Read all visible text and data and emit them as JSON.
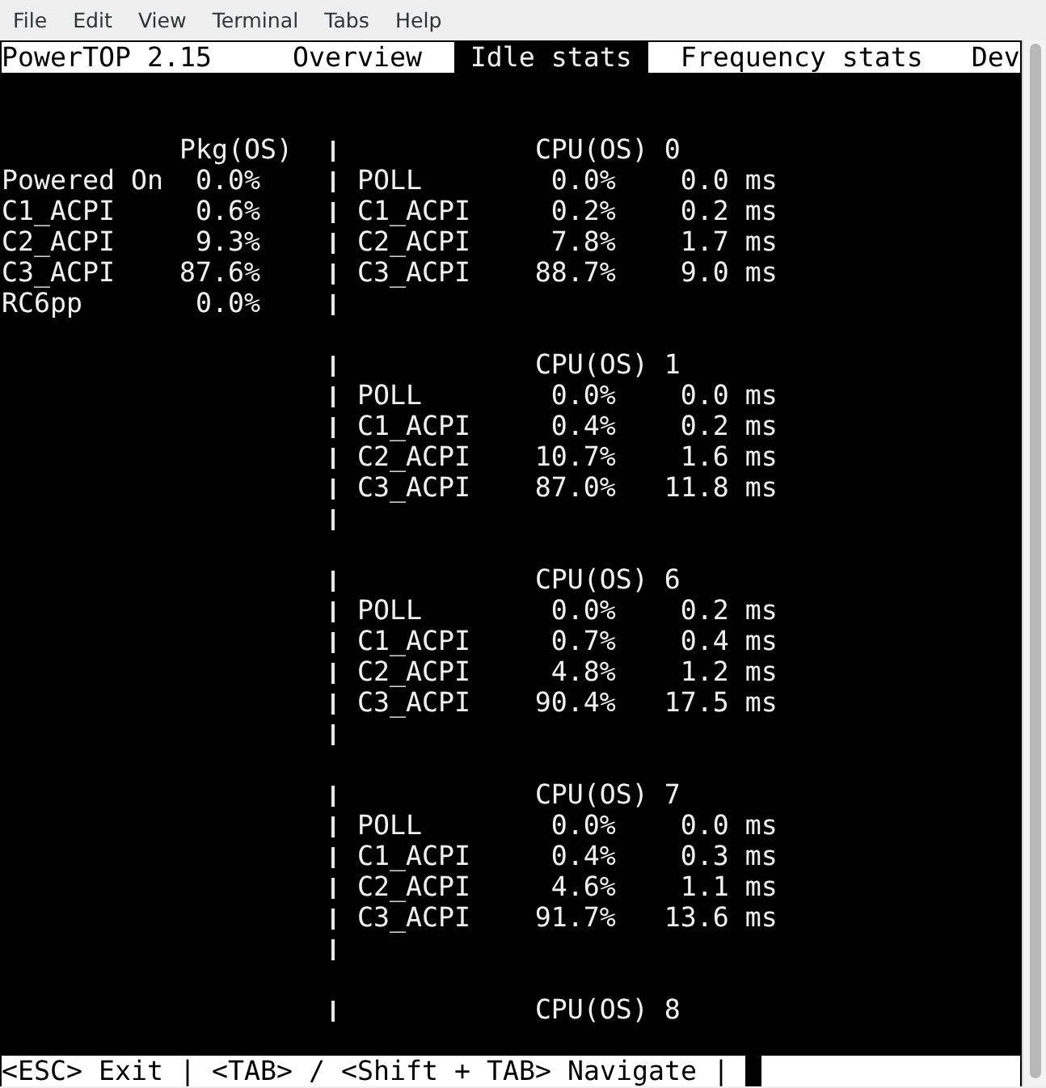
{
  "menu_bar": [
    "File",
    "Edit",
    "View",
    "Terminal",
    "Tabs",
    "Help"
  ],
  "header": {
    "title": "PowerTOP 2.15",
    "tabs": [
      {
        "label": "Overview",
        "selected": false
      },
      {
        "label": "Idle stats",
        "selected": true
      },
      {
        "label": "Frequency stats",
        "selected": false
      },
      {
        "label": "Dev",
        "selected": false
      }
    ]
  },
  "package": {
    "header": "Pkg(OS)",
    "rows": [
      {
        "name": "Powered On",
        "percent": "0.0%"
      },
      {
        "name": "C1_ACPI",
        "percent": "0.6%"
      },
      {
        "name": "C2_ACPI",
        "percent": "9.3%"
      },
      {
        "name": "C3_ACPI",
        "percent": "87.6%"
      },
      {
        "name": "RC6pp",
        "percent": "0.0%"
      }
    ]
  },
  "cpus": [
    {
      "header": "CPU(OS) 0",
      "states": [
        {
          "name": "POLL",
          "percent": "0.0%",
          "time": "0.0 ms"
        },
        {
          "name": "C1_ACPI",
          "percent": "0.2%",
          "time": "0.2 ms"
        },
        {
          "name": "C2_ACPI",
          "percent": "7.8%",
          "time": "1.7 ms"
        },
        {
          "name": "C3_ACPI",
          "percent": "88.7%",
          "time": "9.0 ms"
        }
      ]
    },
    {
      "header": "CPU(OS) 1",
      "states": [
        {
          "name": "POLL",
          "percent": "0.0%",
          "time": "0.0 ms"
        },
        {
          "name": "C1_ACPI",
          "percent": "0.4%",
          "time": "0.2 ms"
        },
        {
          "name": "C2_ACPI",
          "percent": "10.7%",
          "time": "1.6 ms"
        },
        {
          "name": "C3_ACPI",
          "percent": "87.0%",
          "time": "11.8 ms"
        }
      ]
    },
    {
      "header": "CPU(OS) 6",
      "states": [
        {
          "name": "POLL",
          "percent": "0.0%",
          "time": "0.2 ms"
        },
        {
          "name": "C1_ACPI",
          "percent": "0.7%",
          "time": "0.4 ms"
        },
        {
          "name": "C2_ACPI",
          "percent": "4.8%",
          "time": "1.2 ms"
        },
        {
          "name": "C3_ACPI",
          "percent": "90.4%",
          "time": "17.5 ms"
        }
      ]
    },
    {
      "header": "CPU(OS) 7",
      "states": [
        {
          "name": "POLL",
          "percent": "0.0%",
          "time": "0.0 ms"
        },
        {
          "name": "C1_ACPI",
          "percent": "0.4%",
          "time": "0.3 ms"
        },
        {
          "name": "C2_ACPI",
          "percent": "4.6%",
          "time": "1.1 ms"
        },
        {
          "name": "C3_ACPI",
          "percent": "91.7%",
          "time": "13.6 ms"
        }
      ]
    },
    {
      "header": "CPU(OS) 8"
    }
  ],
  "status_bar": {
    "text": "<ESC> Exit | <TAB> / <Shift + TAB> Navigate |"
  }
}
